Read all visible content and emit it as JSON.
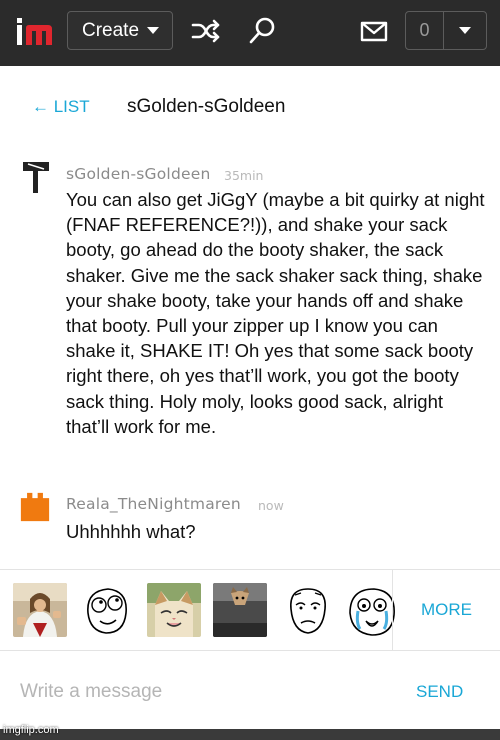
{
  "topbar": {
    "logo_text": "im",
    "create_label": "Create",
    "notification_count": "0"
  },
  "header": {
    "back_label": "← LIST",
    "title": "sGolden-sGoldeen"
  },
  "messages": [
    {
      "user": "sGolden-sGoldeen",
      "time": "35min",
      "text": "You can also get JiGgY (maybe a bit quirky at night (FNAF REFERENCE?!)), and shake your sack booty, go ahead do the booty shaker, the sack shaker. Give me the sack shaker sack thing, shake your shake booty, take your hands off and shake that booty. Pull your zipper up I know you can shake it, SHAKE IT! Oh yes that some sack booty right there, oh yes that’ll work, you got the booty sack thing. Holy moly, looks good sack, alright that’ll work for me.",
      "avatar_icon": "signpost-icon"
    },
    {
      "user": "Reala_TheNightmaren",
      "time": "now",
      "text": "Uhhhhhh what?",
      "avatar_icon": "pixel-avatar-icon",
      "avatar_color": "#f07a10"
    }
  ],
  "meme_bar": {
    "items": [
      "buddy-christ",
      "rage-face-derp",
      "smiling-cat",
      "ceiling-cat",
      "okay-guy",
      "crying-rage-face"
    ],
    "more_label": "MORE"
  },
  "composer": {
    "placeholder": "Write a message",
    "send_label": "SEND"
  },
  "watermark": "imgflip.com",
  "colors": {
    "accent": "#1aa7d6",
    "topbar": "#2b2b2b",
    "logo_red": "#e0262e"
  }
}
